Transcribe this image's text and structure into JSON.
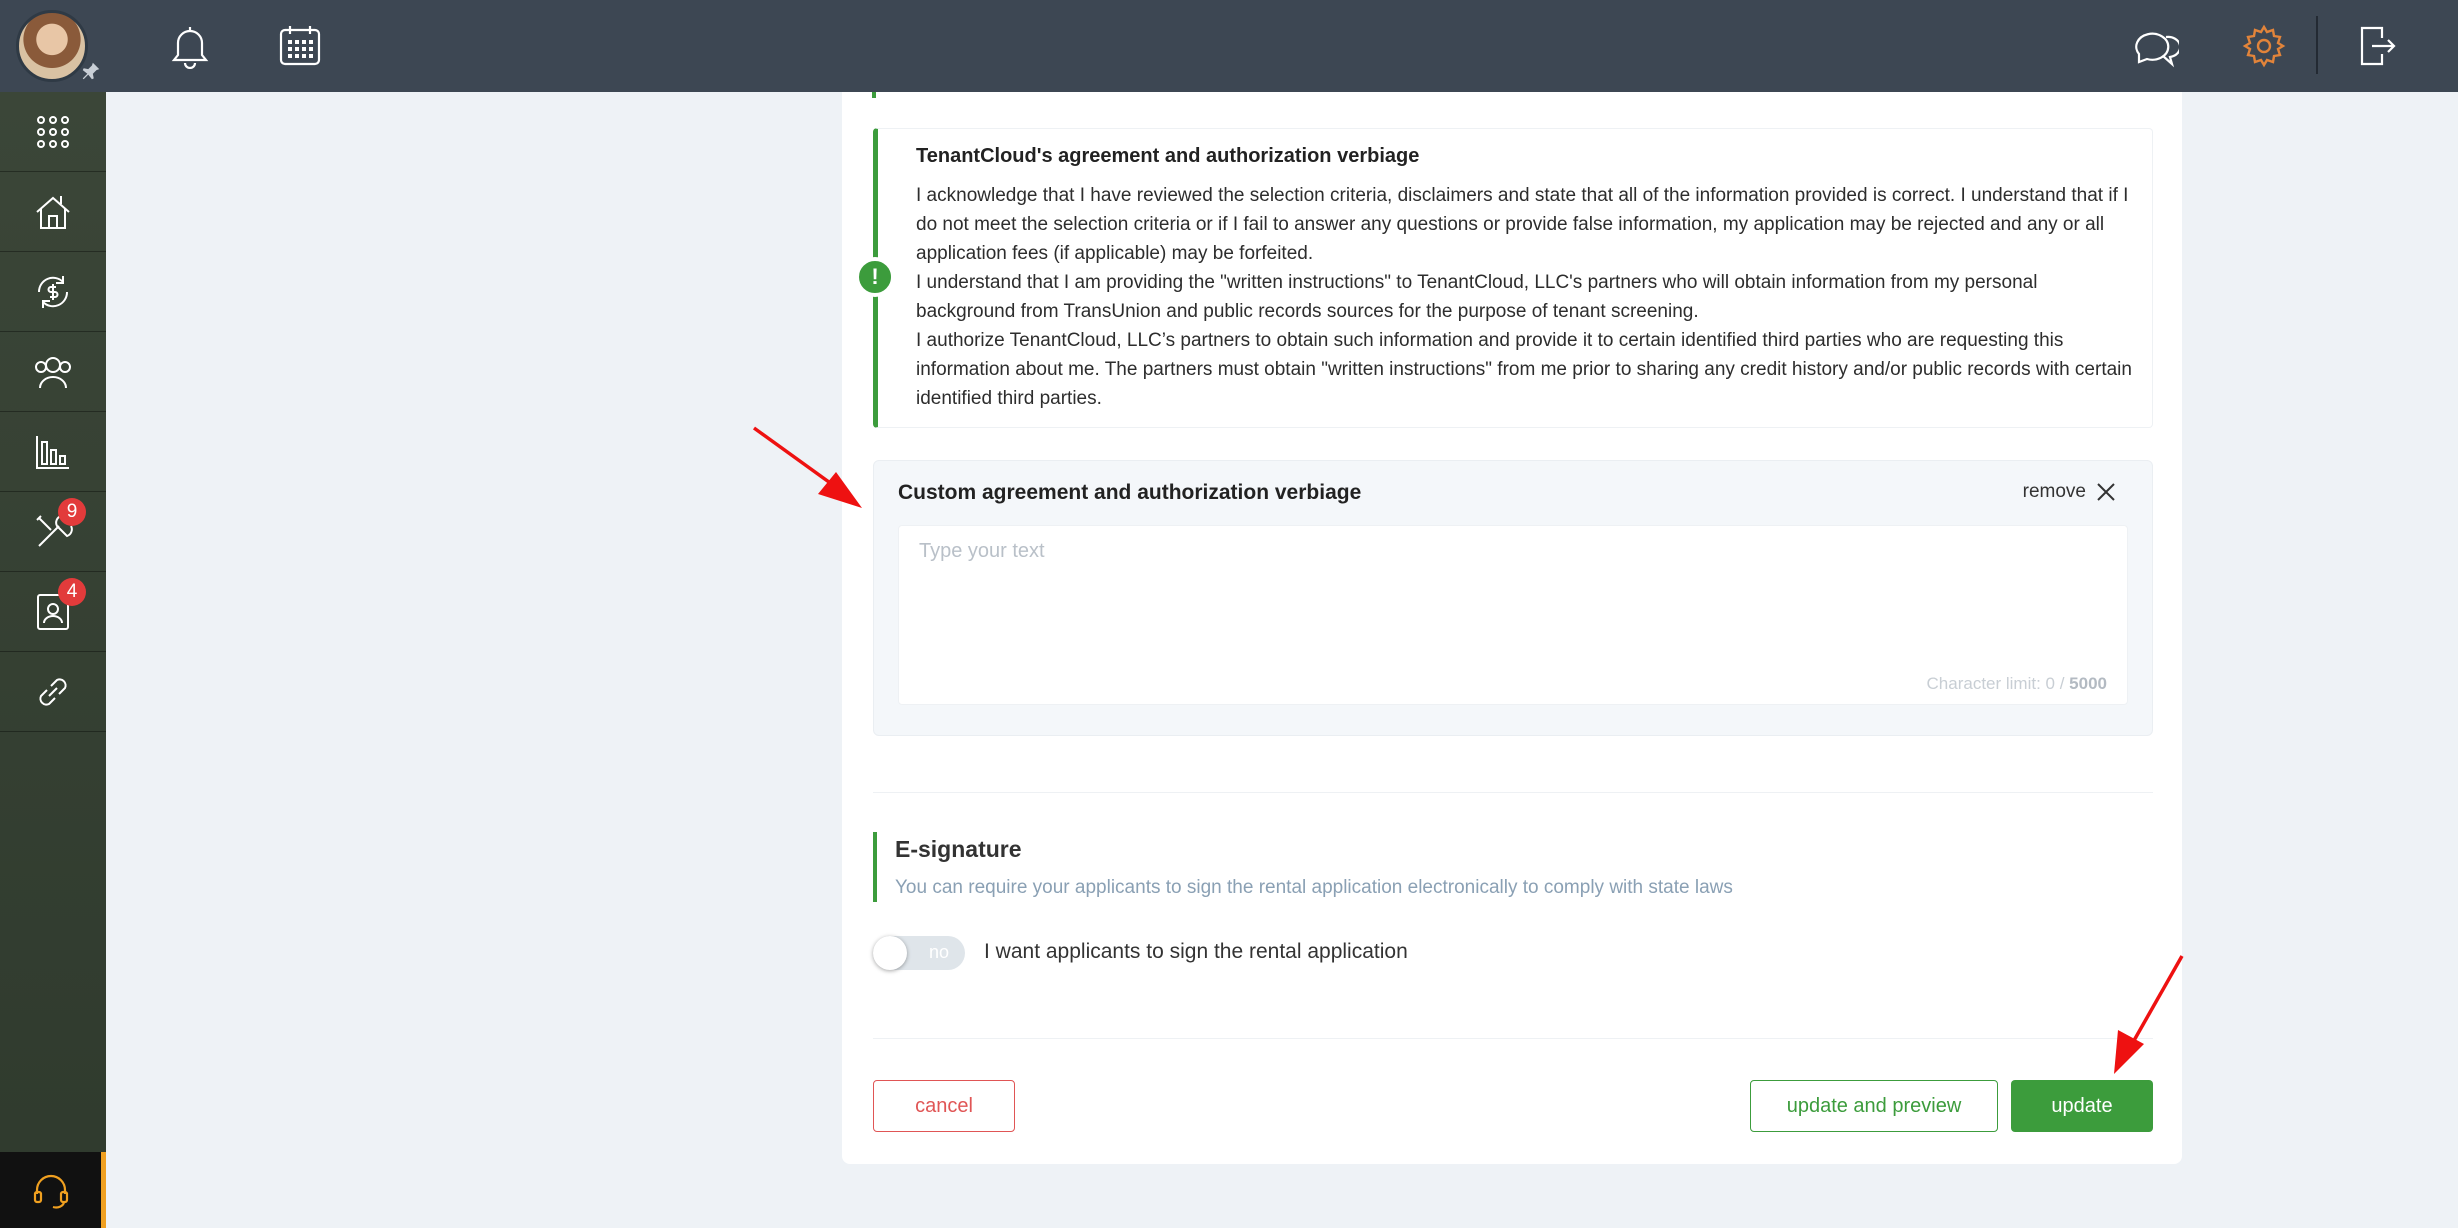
{
  "colors": {
    "accent_green": "#3c9c3c",
    "danger_red": "#e05555",
    "badge_red": "#e23b3b",
    "settings_orange": "#e2843a",
    "annotation_red": "#ee1111"
  },
  "topbar": {
    "icons": [
      "bell-icon",
      "calendar-icon",
      "chat-icon",
      "gear-icon",
      "logout-icon"
    ]
  },
  "sidebar": {
    "items": [
      {
        "icon": "apps-grid-icon"
      },
      {
        "icon": "properties-icon"
      },
      {
        "icon": "payments-icon"
      },
      {
        "icon": "people-icon"
      },
      {
        "icon": "reports-icon"
      },
      {
        "icon": "maintenance-icon",
        "badge": "9"
      },
      {
        "icon": "applications-icon",
        "badge": "4"
      },
      {
        "icon": "link-icon"
      }
    ],
    "support_icon": "headset-icon"
  },
  "verbiage": {
    "title": "TenantCloud's agreement and authorization verbiage",
    "p1": "I acknowledge that I have reviewed the selection criteria, disclaimers and state that all of the information provided is correct. I understand that if I do not meet the selection criteria or if I fail to answer any questions or provide false information, my application may be rejected and any or all application fees (if applicable) may be forfeited.",
    "p2": "I understand that I am providing the \"written instructions\" to TenantCloud, LLC's partners who will obtain information from my personal background from TransUnion and public records sources for the purpose of tenant screening.",
    "p3": "I authorize TenantCloud, LLC’s partners to obtain such information and provide it to certain identified third parties who are requesting this information about me. The partners must obtain \"written instructions\" from me prior to sharing any credit history and/or public records with certain identified third parties."
  },
  "custom": {
    "title": "Custom agreement and authorization verbiage",
    "remove_label": "remove",
    "placeholder": "Type your text",
    "char_limit_prefix": "Character limit: 0 / ",
    "char_limit_max": "5000"
  },
  "esignature": {
    "title": "E-signature",
    "subtitle": "You can require your applicants to sign the rental application electronically to comply with state laws",
    "toggle_state": "no",
    "toggle_label": "I want applicants to sign the rental application"
  },
  "actions": {
    "cancel": "cancel",
    "update_preview": "update and preview",
    "update": "update"
  }
}
